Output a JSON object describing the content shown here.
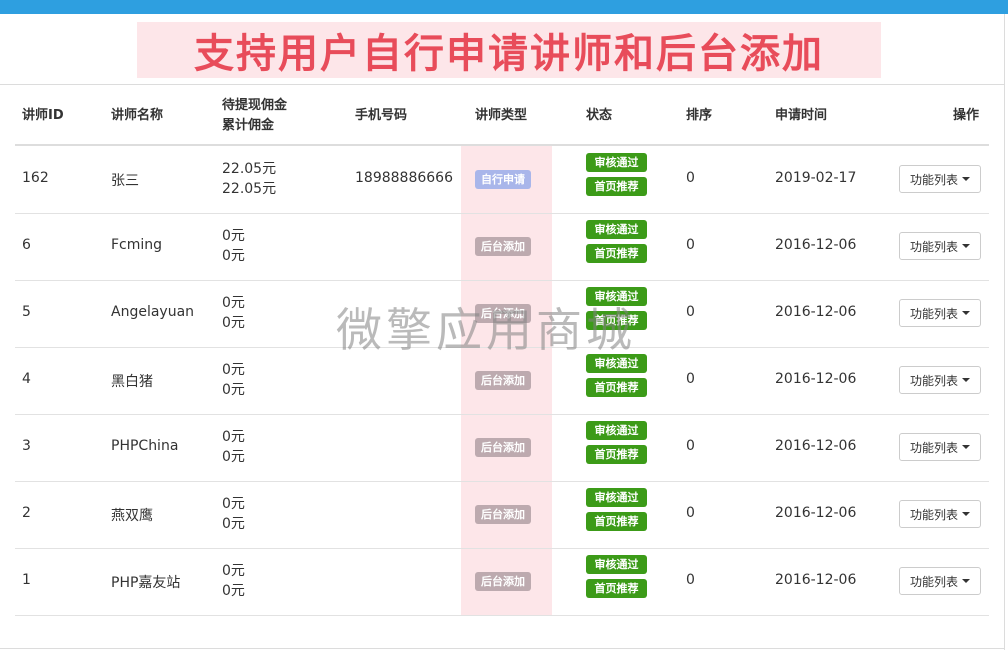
{
  "banner": {
    "title": "支持用户自行申请讲师和后台添加"
  },
  "table": {
    "headers": {
      "id": "讲师ID",
      "name": "讲师名称",
      "commission_pending": "待提现佣金",
      "commission_total": "累计佣金",
      "phone": "手机号码",
      "type": "讲师类型",
      "status": "状态",
      "sort": "排序",
      "time": "申请时间",
      "op": "操作"
    },
    "rows": [
      {
        "id": "162",
        "name": "张三",
        "pending": "22.05元",
        "total": "22.05元",
        "phone": "18988886666",
        "type": "自行申请",
        "status1": "审核通过",
        "status2": "首页推荐",
        "sort": "0",
        "time": "2019-02-17",
        "op": "功能列表"
      },
      {
        "id": "6",
        "name": "Fcming",
        "pending": "0元",
        "total": "0元",
        "phone": "",
        "type": "后台添加",
        "status1": "审核通过",
        "status2": "首页推荐",
        "sort": "0",
        "time": "2016-12-06",
        "op": "功能列表"
      },
      {
        "id": "5",
        "name": "Angelayuan",
        "pending": "0元",
        "total": "0元",
        "phone": "",
        "type": "后台添加",
        "status1": "审核通过",
        "status2": "首页推荐",
        "sort": "0",
        "time": "2016-12-06",
        "op": "功能列表"
      },
      {
        "id": "4",
        "name": "黑白猪",
        "pending": "0元",
        "total": "0元",
        "phone": "",
        "type": "后台添加",
        "status1": "审核通过",
        "status2": "首页推荐",
        "sort": "0",
        "time": "2016-12-06",
        "op": "功能列表"
      },
      {
        "id": "3",
        "name": "PHPChina",
        "pending": "0元",
        "total": "0元",
        "phone": "",
        "type": "后台添加",
        "status1": "审核通过",
        "status2": "首页推荐",
        "sort": "0",
        "time": "2016-12-06",
        "op": "功能列表"
      },
      {
        "id": "2",
        "name": "燕双鹰",
        "pending": "0元",
        "total": "0元",
        "phone": "",
        "type": "后台添加",
        "status1": "审核通过",
        "status2": "首页推荐",
        "sort": "0",
        "time": "2016-12-06",
        "op": "功能列表"
      },
      {
        "id": "1",
        "name": "PHP嘉友站",
        "pending": "0元",
        "total": "0元",
        "phone": "",
        "type": "后台添加",
        "status1": "审核通过",
        "status2": "首页推荐",
        "sort": "0",
        "time": "2016-12-06",
        "op": "功能列表"
      }
    ]
  },
  "watermark": {
    "text": "微擎应用商城"
  },
  "colors": {
    "top_bar": "#2e9fe0",
    "banner_bg": "#fde6e9",
    "banner_text": "#e84c5a",
    "status_green": "#3c9b18",
    "type_self": "#a9b6ea",
    "type_admin": "#bdaaaf"
  }
}
